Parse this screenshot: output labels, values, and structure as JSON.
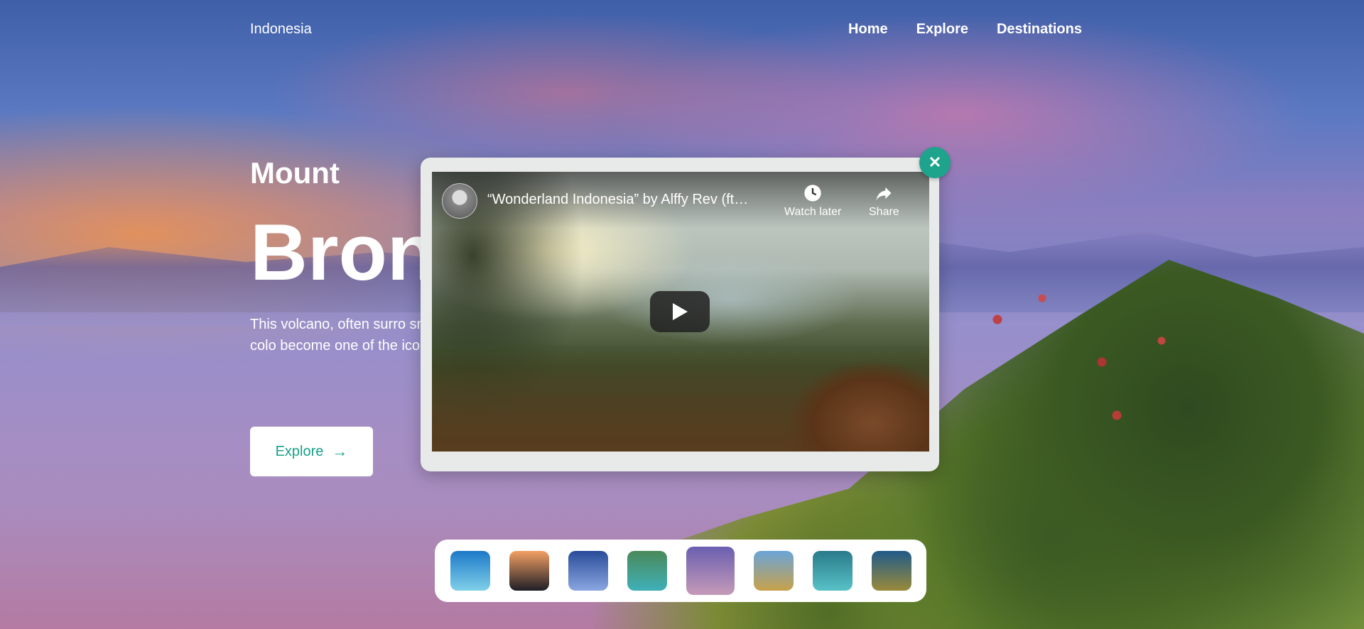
{
  "header": {
    "brand": "Indonesia",
    "nav": [
      "Home",
      "Explore",
      "Destinations"
    ]
  },
  "hero": {
    "subtitle": "Mount",
    "title": "Bron",
    "description": "This volcano, often surro smoke and a multi-colo become one of the iconi Indonesia.",
    "explore_label": "Explore"
  },
  "video": {
    "title": "“Wonderland Indonesia” by Alffy Rev (ft…",
    "watch_later_label": "Watch later",
    "share_label": "Share"
  },
  "thumbnails": [
    {
      "colors": [
        "#1c79c9",
        "#7fd0e8"
      ]
    },
    {
      "colors": [
        "#f4a064",
        "#1e1e26"
      ]
    },
    {
      "colors": [
        "#2a4c9a",
        "#8aa6e0"
      ]
    },
    {
      "colors": [
        "#4a8a5a",
        "#3fb0b8"
      ]
    },
    {
      "colors": [
        "#6a5fb0",
        "#c59ab8"
      ],
      "active": true
    },
    {
      "colors": [
        "#6aa4d8",
        "#c8a24a"
      ]
    },
    {
      "colors": [
        "#2a7a8a",
        "#58c2c8"
      ]
    },
    {
      "colors": [
        "#1f5a8a",
        "#9a8a3a"
      ]
    }
  ],
  "colors": {
    "accent": "#1ea38c",
    "button_text": "#19a08a"
  }
}
